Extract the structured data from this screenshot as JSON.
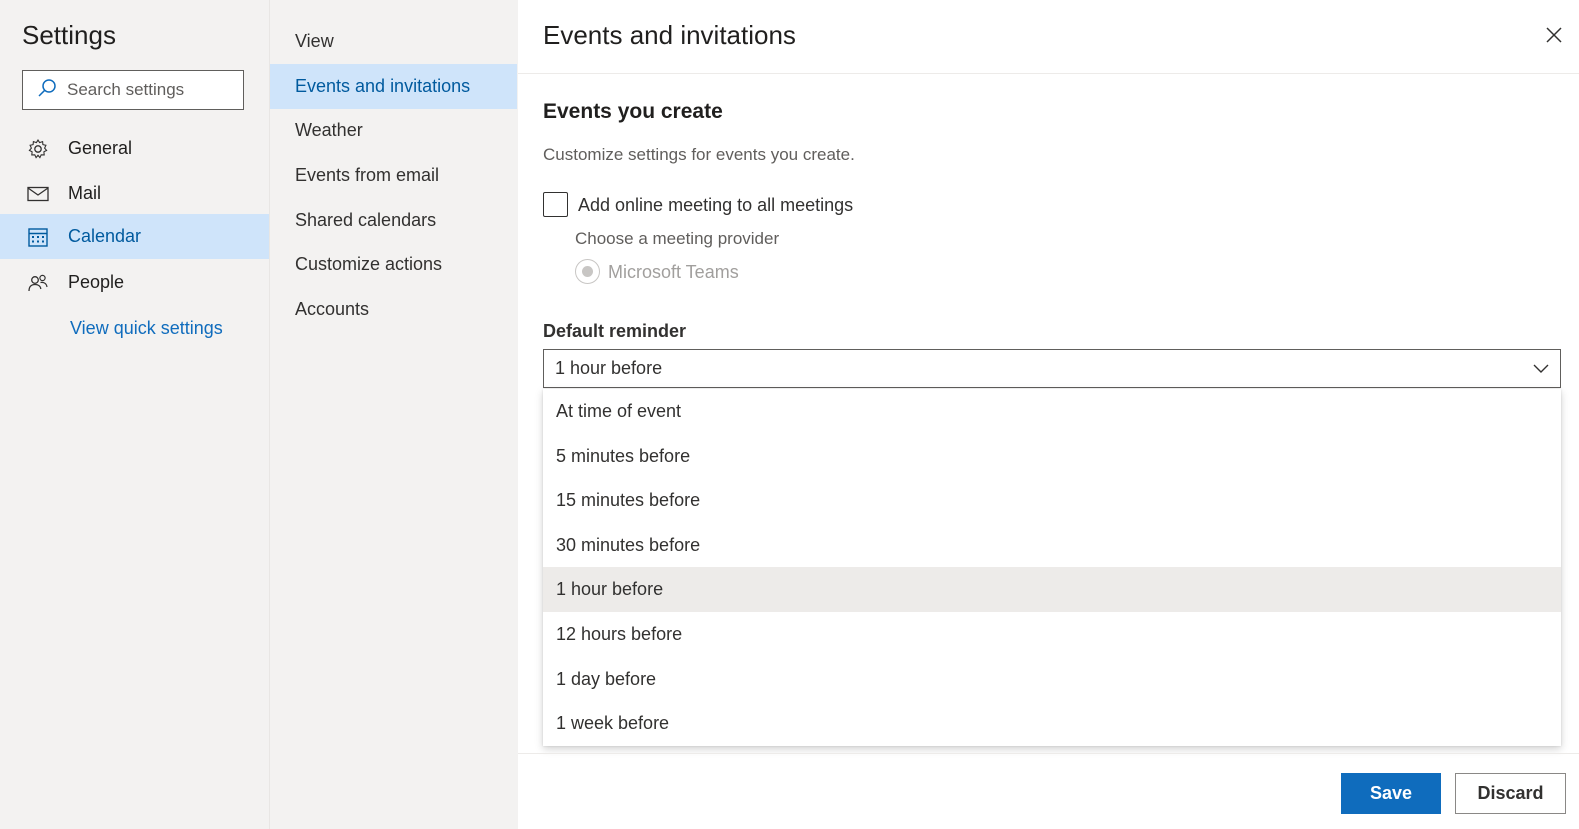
{
  "settings": {
    "title": "Settings",
    "search_placeholder": "Search settings",
    "nav": [
      {
        "label": "General",
        "icon": "gear-icon"
      },
      {
        "label": "Mail",
        "icon": "mail-icon"
      },
      {
        "label": "Calendar",
        "icon": "calendar-icon",
        "active": true
      },
      {
        "label": "People",
        "icon": "people-icon"
      }
    ],
    "quick_settings_link": "View quick settings"
  },
  "calendar_menu": {
    "items": [
      {
        "label": "View"
      },
      {
        "label": "Events and invitations",
        "active": true
      },
      {
        "label": "Weather"
      },
      {
        "label": "Events from email"
      },
      {
        "label": "Shared calendars"
      },
      {
        "label": "Customize actions"
      },
      {
        "label": "Accounts"
      }
    ]
  },
  "panel": {
    "title": "Events and invitations",
    "section_title": "Events you create",
    "section_desc": "Customize settings for events you create.",
    "online_meeting": {
      "label": "Add online meeting to all meetings",
      "checked": false
    },
    "provider_label": "Choose a meeting provider",
    "provider_option": "Microsoft Teams",
    "reminder_label": "Default reminder",
    "reminder_value": "1 hour before",
    "reminder_options": [
      "At time of event",
      "5 minutes before",
      "15 minutes before",
      "30 minutes before",
      "1 hour before",
      "12 hours before",
      "1 day before",
      "1 week before"
    ],
    "selected_option": "1 hour before",
    "save_label": "Save",
    "discard_label": "Discard"
  },
  "colors": {
    "accent": "#0f6cbd",
    "selected_bg": "#cfe4fa",
    "pane_bg": "#f3f2f1"
  }
}
